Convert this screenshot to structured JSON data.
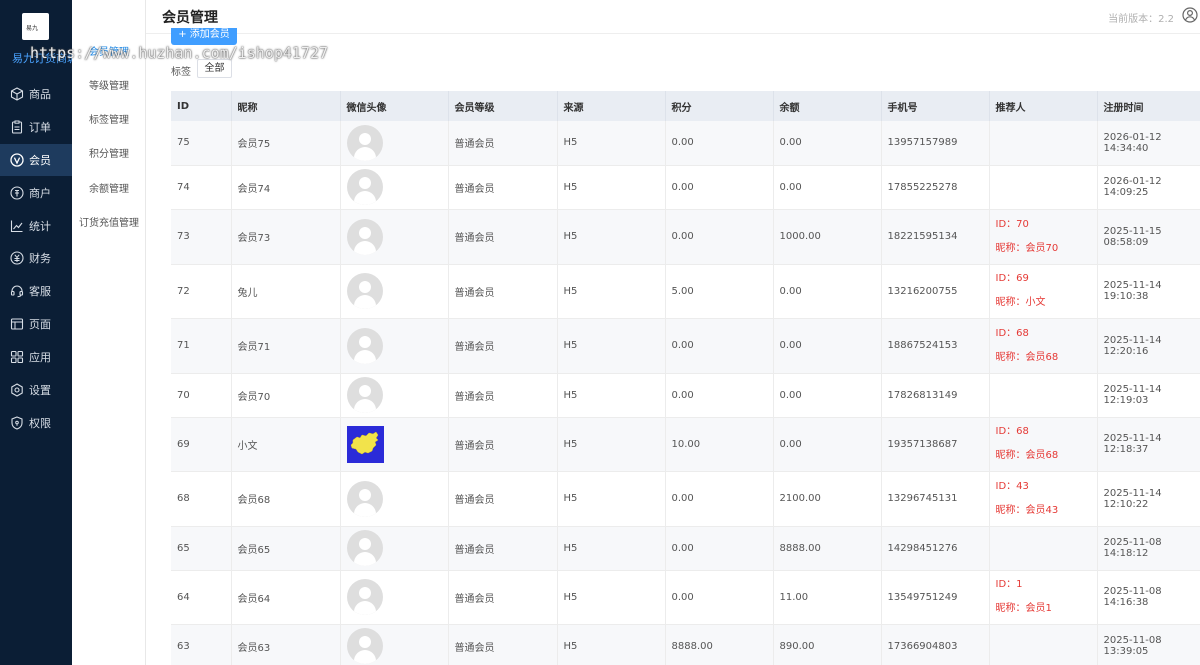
{
  "brand": {
    "logo_text": "易九",
    "name": "易九订货商城"
  },
  "nav": [
    {
      "label": "商品",
      "icon": "cube-icon"
    },
    {
      "label": "订单",
      "icon": "clipboard-icon"
    },
    {
      "label": "会员",
      "icon": "member-v-icon",
      "active": true
    },
    {
      "label": "商户",
      "icon": "merchant-icon"
    },
    {
      "label": "统计",
      "icon": "chart-line-icon"
    },
    {
      "label": "财务",
      "icon": "finance-icon"
    },
    {
      "label": "客服",
      "icon": "headset-icon"
    },
    {
      "label": "页面",
      "icon": "page-icon"
    },
    {
      "label": "应用",
      "icon": "apps-icon"
    },
    {
      "label": "设置",
      "icon": "gear-icon"
    },
    {
      "label": "权限",
      "icon": "shield-icon"
    }
  ],
  "submenu": [
    {
      "label": "会员管理",
      "active": true
    },
    {
      "label": "等级管理"
    },
    {
      "label": "标签管理"
    },
    {
      "label": "积分管理"
    },
    {
      "label": "余额管理"
    },
    {
      "label": "订货充值管理"
    }
  ],
  "header": {
    "title": "会员管理",
    "version": "当前版本：2.2"
  },
  "toolbar": {
    "add_label": "+ 添加会员",
    "tag_label": "标签",
    "tag_all": "全部"
  },
  "table": {
    "columns": [
      "ID",
      "昵称",
      "微信头像",
      "会员等级",
      "来源",
      "积分",
      "余额",
      "手机号",
      "推荐人",
      "注册时间"
    ],
    "rows": [
      {
        "id": "75",
        "nick": "会员75",
        "avatar": "default",
        "level": "普通会员",
        "source": "H5",
        "points": "0.00",
        "balance": "0.00",
        "phone": "13957157989",
        "ref_id": "",
        "ref_nick": "",
        "time": "2026-01-12 14:34:40"
      },
      {
        "id": "74",
        "nick": "会员74",
        "avatar": "default",
        "level": "普通会员",
        "source": "H5",
        "points": "0.00",
        "balance": "0.00",
        "phone": "17855225278",
        "ref_id": "",
        "ref_nick": "",
        "time": "2026-01-12 14:09:25"
      },
      {
        "id": "73",
        "nick": "会员73",
        "avatar": "default",
        "level": "普通会员",
        "source": "H5",
        "points": "0.00",
        "balance": "1000.00",
        "phone": "18221595134",
        "ref_id": "ID：70",
        "ref_nick": "昵称：会员70",
        "time": "2025-11-15 08:58:09"
      },
      {
        "id": "72",
        "nick": "兔儿",
        "avatar": "default",
        "level": "普通会员",
        "source": "H5",
        "points": "5.00",
        "balance": "0.00",
        "phone": "13216200755",
        "ref_id": "ID：69",
        "ref_nick": "昵称：小文",
        "time": "2025-11-14 19:10:38"
      },
      {
        "id": "71",
        "nick": "会员71",
        "avatar": "default",
        "level": "普通会员",
        "source": "H5",
        "points": "0.00",
        "balance": "0.00",
        "phone": "18867524153",
        "ref_id": "ID：68",
        "ref_nick": "昵称：会员68",
        "time": "2025-11-14 12:20:16"
      },
      {
        "id": "70",
        "nick": "会员70",
        "avatar": "default",
        "level": "普通会员",
        "source": "H5",
        "points": "0.00",
        "balance": "0.00",
        "phone": "17826813149",
        "ref_id": "",
        "ref_nick": "",
        "time": "2025-11-14 12:19:03"
      },
      {
        "id": "69",
        "nick": "小文",
        "avatar": "map",
        "level": "普通会员",
        "source": "H5",
        "points": "10.00",
        "balance": "0.00",
        "phone": "19357138687",
        "ref_id": "ID：68",
        "ref_nick": "昵称：会员68",
        "time": "2025-11-14 12:18:37"
      },
      {
        "id": "68",
        "nick": "会员68",
        "avatar": "default",
        "level": "普通会员",
        "source": "H5",
        "points": "0.00",
        "balance": "2100.00",
        "phone": "13296745131",
        "ref_id": "ID：43",
        "ref_nick": "昵称：会员43",
        "time": "2025-11-14 12:10:22"
      },
      {
        "id": "65",
        "nick": "会员65",
        "avatar": "default",
        "level": "普通会员",
        "source": "H5",
        "points": "0.00",
        "balance": "8888.00",
        "phone": "14298451276",
        "ref_id": "",
        "ref_nick": "",
        "time": "2025-11-08 14:18:12"
      },
      {
        "id": "64",
        "nick": "会员64",
        "avatar": "default",
        "level": "普通会员",
        "source": "H5",
        "points": "0.00",
        "balance": "11.00",
        "phone": "13549751249",
        "ref_id": "ID：1",
        "ref_nick": "昵称：会员1",
        "time": "2025-11-08 14:16:38"
      },
      {
        "id": "63",
        "nick": "会员63",
        "avatar": "default",
        "level": "普通会员",
        "source": "H5",
        "points": "8888.00",
        "balance": "890.00",
        "phone": "17366904803",
        "ref_id": "",
        "ref_nick": "",
        "time": "2025-11-08 13:39:05"
      }
    ]
  },
  "watermark": "https://www.huzhan.com/ishop41727",
  "colors": {
    "sidebar_bg": "#0b1e35",
    "accent": "#409eff",
    "referrer_red": "#e53935"
  }
}
